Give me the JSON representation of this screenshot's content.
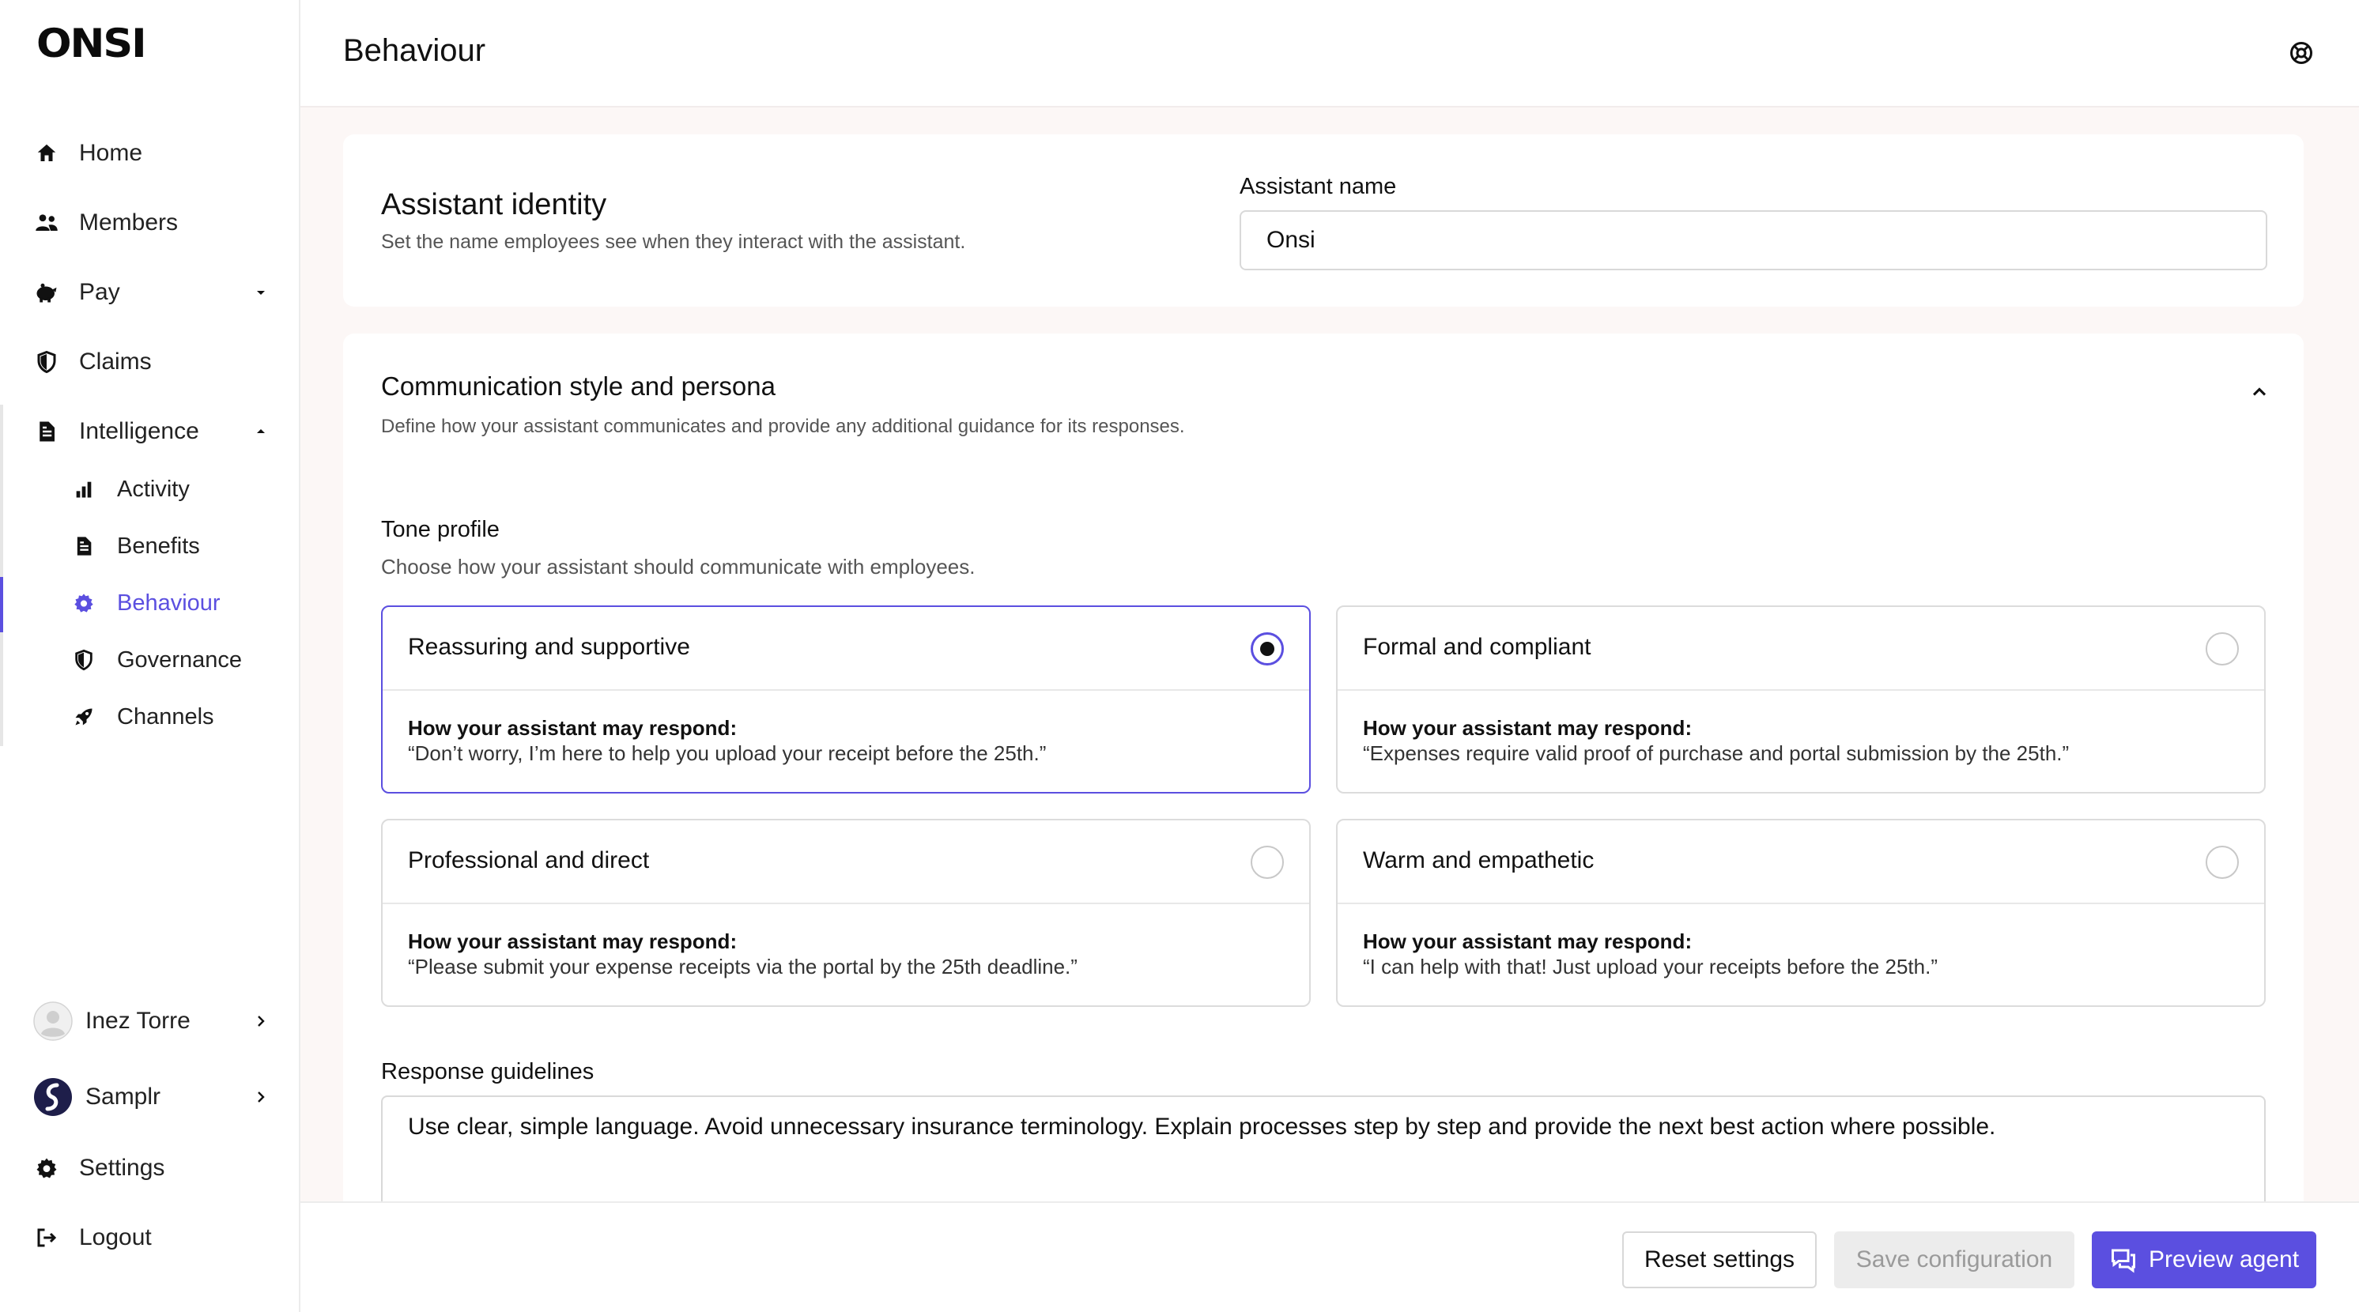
{
  "app": {
    "logo_text": "ONSI"
  },
  "sidebar": {
    "items": [
      {
        "label": "Home",
        "icon": "home-icon"
      },
      {
        "label": "Members",
        "icon": "members-icon"
      },
      {
        "label": "Pay",
        "icon": "piggy-bank-icon"
      },
      {
        "label": "Claims",
        "icon": "shield-icon"
      },
      {
        "label": "Intelligence",
        "icon": "document-icon"
      }
    ],
    "sub_items": [
      {
        "label": "Activity",
        "icon": "bar-chart-icon"
      },
      {
        "label": "Benefits",
        "icon": "document-icon"
      },
      {
        "label": "Behaviour",
        "icon": "gear-icon",
        "active": true
      },
      {
        "label": "Governance",
        "icon": "shield-icon"
      },
      {
        "label": "Channels",
        "icon": "rocket-icon"
      }
    ],
    "user": {
      "name": "Inez Torre"
    },
    "org": {
      "name": "Samplr"
    },
    "settings_label": "Settings",
    "logout_label": "Logout"
  },
  "header": {
    "title": "Behaviour"
  },
  "identity": {
    "title": "Assistant identity",
    "subtitle": "Set the name employees see when they interact with the assistant.",
    "name_label": "Assistant name",
    "name_value": "Onsi"
  },
  "communication": {
    "title": "Communication style and persona",
    "subtitle": "Define how your assistant communicates and provide any additional guidance for its responses.",
    "tone_label": "Tone profile",
    "tone_sub": "Choose how your assistant should communicate with employees.",
    "response_label": "How your assistant may respond:",
    "tones": [
      {
        "title": "Reassuring and supportive",
        "example": "“Don’t worry, I’m here to help you upload your receipt before the 25th.”",
        "selected": true
      },
      {
        "title": "Formal and compliant",
        "example": "“Expenses require valid proof of purchase and portal submission by the 25th.”",
        "selected": false
      },
      {
        "title": "Professional and direct",
        "example": "“Please submit your expense receipts via the portal by the 25th deadline.”",
        "selected": false
      },
      {
        "title": "Warm and empathetic",
        "example": "“I can help with that! Just upload your receipts before the 25th.”",
        "selected": false
      }
    ],
    "guidelines_label": "Response guidelines",
    "guidelines_value": "Use clear, simple language. Avoid unnecessary insurance terminology. Explain processes step by step and provide the next best action where possible."
  },
  "footer": {
    "reset_label": "Reset settings",
    "save_label": "Save configuration",
    "preview_label": "Preview agent"
  },
  "colors": {
    "accent": "#5b4fe0",
    "background": "#fcf7f6"
  }
}
